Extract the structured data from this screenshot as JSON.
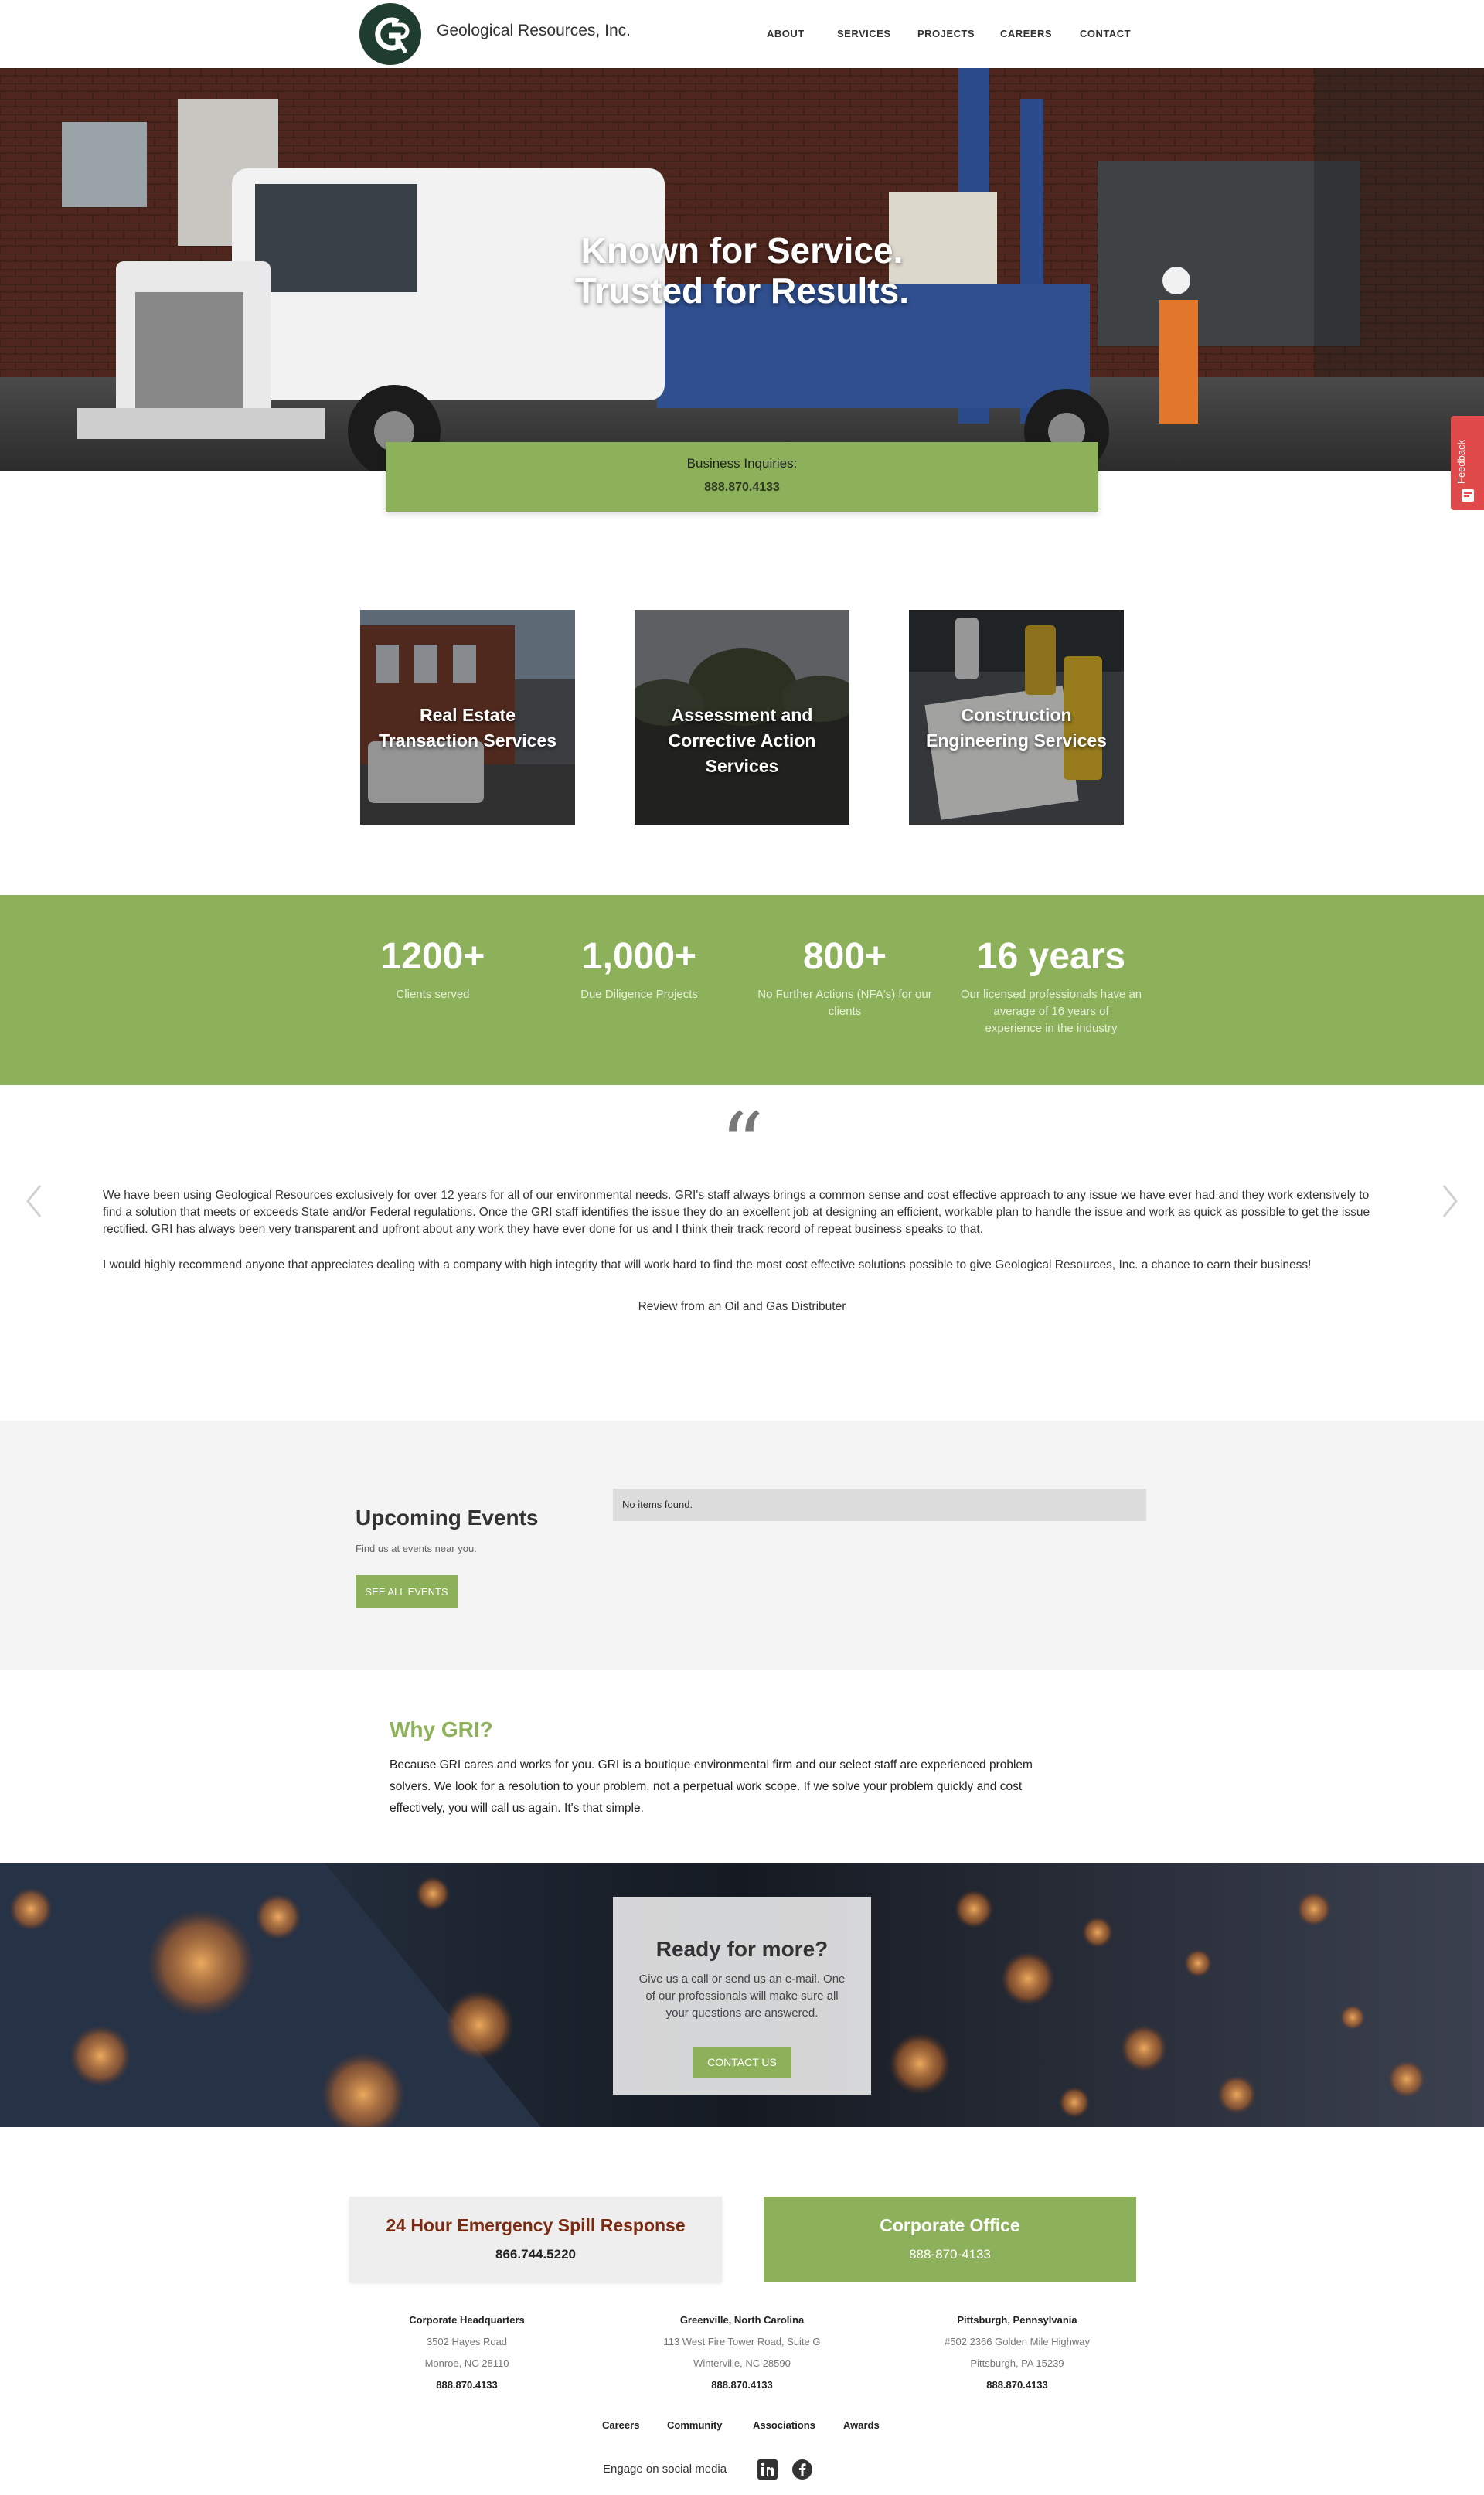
{
  "header": {
    "brand": "Geological Resources, Inc.",
    "nav": [
      {
        "label": "ABOUT"
      },
      {
        "label": "SERVICES"
      },
      {
        "label": "PROJECTS"
      },
      {
        "label": "CAREERS"
      },
      {
        "label": "CONTACT"
      }
    ]
  },
  "hero": {
    "line1": "Known for Service.",
    "line2": "Trusted for Results.",
    "inquiry_label": "Business Inquiries:",
    "inquiry_phone": "888.870.4133",
    "feedback": "Feedback"
  },
  "services": [
    {
      "line1": "Real Estate",
      "line2": "Transaction Services",
      "line3": ""
    },
    {
      "line1": "Assessment and",
      "line2": "Corrective Action",
      "line3": "Services"
    },
    {
      "line1": "Construction",
      "line2": "Engineering Services",
      "line3": ""
    }
  ],
  "stats": [
    {
      "num": "1200+",
      "l1": "Clients served",
      "l2": "",
      "l3": ""
    },
    {
      "num": "1,000+",
      "l1": "Due Diligence Projects",
      "l2": "",
      "l3": ""
    },
    {
      "num": "800+",
      "l1": "No Further Actions (NFA's) for our",
      "l2": "clients",
      "l3": ""
    },
    {
      "num": "16 years",
      "l1": "Our licensed professionals have an",
      "l2": "average of 16 years of",
      "l3": "experience in the industry"
    }
  ],
  "testimonial": {
    "quote_mark": "“",
    "p1": "We have been using Geological Resources exclusively for over 12 years for all of our environmental needs. GRI's staff always brings a common sense and cost effective approach to any issue we have ever had and they work extensively to find a solution that meets or exceeds State and/or Federal regulations. Once the GRI staff identifies the issue they do an excellent job at designing an efficient, workable plan to handle the issue and work as quick as possible to get the issue rectified. GRI has always been very transparent and upfront about any work they have ever done for us and I think their track record of repeat business speaks to that.",
    "p2": "I would highly recommend anyone that appreciates dealing with a company with high integrity that will work hard to find the most cost effective solutions possible to give Geological Resources, Inc. a chance to earn their business!",
    "source": "Review from an Oil and Gas Distributer"
  },
  "events": {
    "title": "Upcoming Events",
    "subtitle": "Find us at events near you.",
    "button": "SEE ALL EVENTS",
    "empty": "No items found."
  },
  "why": {
    "title": "Why GRI?",
    "line1": "Because GRI cares and works for you. GRI is a boutique environmental firm and our select staff are experienced problem",
    "line2": "solvers. We look for a resolution to your problem, not a perpetual work scope. If we solve your problem quickly and cost",
    "line3": "effectively, you will call us again. It's that simple."
  },
  "cta": {
    "title": "Ready for more?",
    "l1": "Give us a call or send us an e-mail. One",
    "l2": "of our professionals will make sure all",
    "l3": "your questions are answered.",
    "button": "CONTACT US"
  },
  "footer": {
    "spill_title": "24 Hour Emergency Spill Response",
    "spill_phone": "866.744.5220",
    "corp_title": "Corporate Office",
    "corp_phone": "888-870-4133",
    "offices": [
      {
        "heading": "Corporate Headquarters",
        "addr1": "3502 Hayes Road",
        "addr2": "Monroe, NC  28110",
        "phone": "888.870.4133"
      },
      {
        "heading": "Greenville, North Carolina",
        "addr1": "113 West Fire Tower Road, Suite G",
        "addr2": "Winterville, NC  28590",
        "phone": "888.870.4133"
      },
      {
        "heading": "Pittsburgh, Pennsylvania",
        "addr1": "#502 2366 Golden Mile Highway",
        "addr2": "Pittsburgh, PA 15239",
        "phone": "888.870.4133"
      }
    ],
    "links": [
      {
        "label": "Careers"
      },
      {
        "label": "Community"
      },
      {
        "label": "Associations"
      },
      {
        "label": "Awards"
      }
    ],
    "social_label": "Engage on social media",
    "social_icons": [
      "linkedin-icon",
      "facebook-icon"
    ]
  },
  "colors": {
    "brand_green": "#8db15a",
    "logo_dark": "#1e3d2f",
    "spill_red": "#7a2a10",
    "feedback_red": "#e04a4a"
  }
}
